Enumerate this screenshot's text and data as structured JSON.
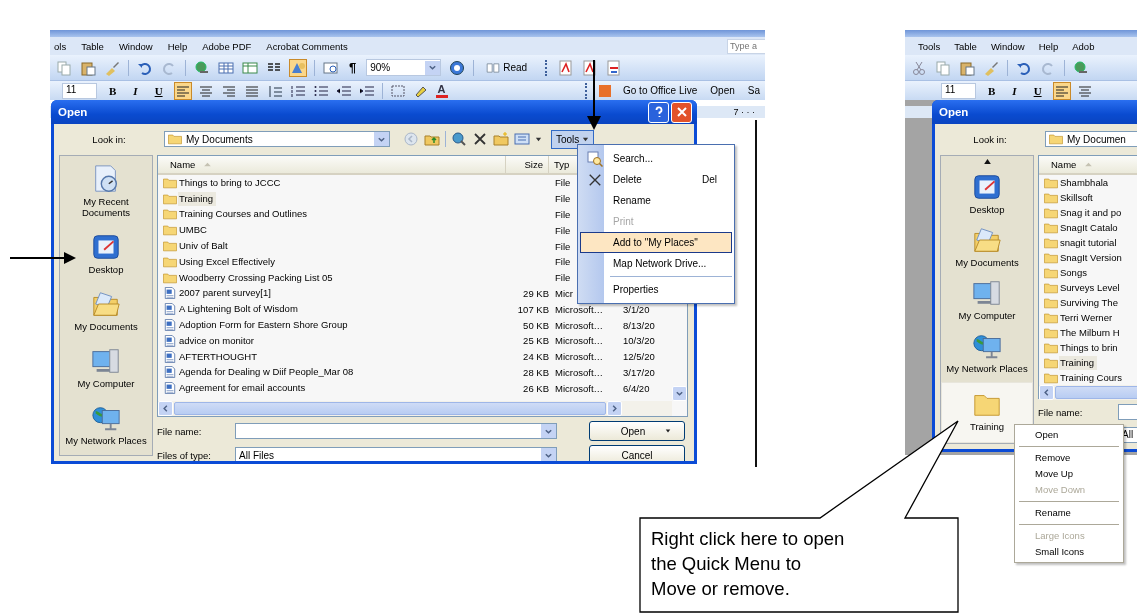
{
  "left_screenshot": {
    "menu_bar": [
      "ols",
      "Table",
      "Window",
      "Help",
      "Adobe PDF",
      "Acrobat Comments"
    ],
    "help_field": {
      "placeholder": "Type a"
    },
    "zoom": "90%",
    "pilcrow": "¶",
    "read_button": "Read",
    "font_size": "11",
    "format_buttons": [
      "B",
      "I",
      "U"
    ],
    "font_color": "A",
    "task_buttons": [
      "Go to Office Live",
      "Open",
      "Sa"
    ],
    "ruler": "7 · · ·",
    "dialog": {
      "title": "Open",
      "look_in_label": "Look in:",
      "look_in_value": "My Documents",
      "tools_button": {
        "label": "Tools",
        "pressed": true
      },
      "places": [
        {
          "label": "My Recent Documents",
          "kind": "recent",
          "selected": false
        },
        {
          "label": "Desktop",
          "kind": "desktop",
          "selected": false
        },
        {
          "label": "My Documents",
          "kind": "documents",
          "selected": false
        },
        {
          "label": "My Computer",
          "kind": "computer",
          "selected": false
        },
        {
          "label": "My Network Places",
          "kind": "network",
          "selected": false
        }
      ],
      "columns": [
        "Name",
        "Size",
        "Typ"
      ],
      "files": [
        {
          "kind": "folder",
          "name": "Things to bring to JCCC",
          "type": "File",
          "selected": false
        },
        {
          "kind": "folder",
          "name": "Training",
          "type": "File",
          "selected": true
        },
        {
          "kind": "folder",
          "name": "Training Courses and Outlines",
          "type": "File",
          "selected": false
        },
        {
          "kind": "folder",
          "name": "UMBC",
          "type": "File",
          "selected": false
        },
        {
          "kind": "folder",
          "name": "Univ of Balt",
          "type": "File",
          "selected": false
        },
        {
          "kind": "folder",
          "name": "Using Excel Effectively",
          "type": "File",
          "selected": false
        },
        {
          "kind": "folder",
          "name": "Woodberry Crossing Packing List 05",
          "type": "File",
          "selected": false
        },
        {
          "kind": "document",
          "name": "2007 parent survey[1]",
          "size": "29 KB",
          "type": "Micr",
          "selected": false
        },
        {
          "kind": "document",
          "name": "A Lightening Bolt of Wisdom",
          "size": "107 KB",
          "type": "Microsoft…",
          "modified": "3/1/20",
          "selected": false
        },
        {
          "kind": "document",
          "name": "Adoption Form for Eastern Shore Group",
          "size": "50 KB",
          "type": "Microsoft…",
          "modified": "8/13/20",
          "selected": false
        },
        {
          "kind": "document",
          "name": "advice on monitor",
          "size": "25 KB",
          "type": "Microsoft…",
          "modified": "10/3/20",
          "selected": false
        },
        {
          "kind": "document",
          "name": "AFTERTHOUGHT",
          "size": "24 KB",
          "type": "Microsoft…",
          "modified": "12/5/20",
          "selected": false
        },
        {
          "kind": "document",
          "name": "Agenda for Dealing w Diif People_Mar 08",
          "size": "28 KB",
          "type": "Microsoft…",
          "modified": "3/17/20",
          "selected": false
        },
        {
          "kind": "document",
          "name": "Agreement for email accounts",
          "size": "26 KB",
          "type": "Microsoft…",
          "modified": "6/4/20",
          "selected": false
        }
      ],
      "file_name_label": "File name:",
      "file_type_label": "Files of type:",
      "file_type_value": "All Files",
      "buttons": [
        "Open",
        "Cancel"
      ]
    },
    "tools_menu": [
      {
        "kind": "search",
        "label": "Search...",
        "disabled": false,
        "selected": false
      },
      {
        "kind": "delete",
        "label": "Delete",
        "shortcut": "Del",
        "disabled": false,
        "selected": false
      },
      {
        "kind": "text",
        "label": "Rename",
        "disabled": false,
        "selected": false
      },
      {
        "kind": "text",
        "label": "Print",
        "disabled": true,
        "selected": false
      },
      {
        "kind": "text",
        "label": "Add to \"My Places\"",
        "disabled": false,
        "selected": true
      },
      {
        "kind": "text",
        "label": "Map Network Drive...",
        "disabled": false,
        "selected": false
      },
      {
        "kind": "text",
        "label": "Properties",
        "disabled": false,
        "selected": false,
        "separator_before": true
      }
    ]
  },
  "right_screenshot": {
    "menu_bar": [
      "Tools",
      "Table",
      "Window",
      "Help",
      "Adob"
    ],
    "font_size": "11",
    "format_buttons": [
      "B",
      "I",
      "U"
    ],
    "dialog": {
      "title": "Open",
      "look_in_label": "Look in:",
      "look_in_value": "My Documen",
      "places": [
        {
          "label": "Desktop",
          "kind": "desktop",
          "selected": false
        },
        {
          "label": "My Documents",
          "kind": "documents",
          "selected": false
        },
        {
          "label": "My Computer",
          "kind": "computer",
          "selected": false
        },
        {
          "label": "My Network Places",
          "kind": "network",
          "selected": false
        },
        {
          "label": "Training",
          "kind": "folder",
          "selected": true
        }
      ],
      "columns": [
        "Name"
      ],
      "files": [
        {
          "kind": "folder",
          "name": "Shambhala",
          "selected": false
        },
        {
          "kind": "folder",
          "name": "Skillsoft",
          "selected": false
        },
        {
          "kind": "folder",
          "name": "Snag it and po",
          "selected": false
        },
        {
          "kind": "folder",
          "name": "SnagIt Catalo",
          "selected": false
        },
        {
          "kind": "folder",
          "name": "snagit tutorial",
          "selected": false
        },
        {
          "kind": "folder",
          "name": "SnagIt Version",
          "selected": false
        },
        {
          "kind": "folder",
          "name": "Songs",
          "selected": false
        },
        {
          "kind": "folder",
          "name": "Surveys Level",
          "selected": false
        },
        {
          "kind": "folder",
          "name": "Surviving The",
          "selected": false
        },
        {
          "kind": "folder",
          "name": "Terri Werner",
          "selected": false
        },
        {
          "kind": "folder",
          "name": "The Milburn H",
          "selected": false
        },
        {
          "kind": "folder",
          "name": "Things to brin",
          "selected": false
        },
        {
          "kind": "folder",
          "name": "Training",
          "selected": true
        },
        {
          "kind": "folder",
          "name": "Training Cours",
          "selected": false
        }
      ],
      "file_name_label": "File name:",
      "file_type_value": "All"
    },
    "context_menu": [
      {
        "label": "Open",
        "disabled": false,
        "separator_before": false
      },
      {
        "label": "Remove",
        "disabled": false,
        "separator_before": true
      },
      {
        "label": "Move Up",
        "disabled": false,
        "separator_before": false
      },
      {
        "label": "Move Down",
        "disabled": true,
        "separator_before": false
      },
      {
        "label": "Rename",
        "disabled": false,
        "separator_before": true
      },
      {
        "label": "Large Icons",
        "disabled": true,
        "separator_before": true
      },
      {
        "label": "Small Icons",
        "disabled": false,
        "separator_before": false
      }
    ]
  },
  "callout": "Right click here to open\nthe Quick Menu to\nMove or remove."
}
